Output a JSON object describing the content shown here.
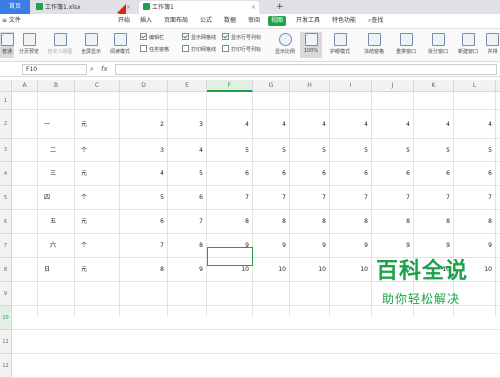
{
  "tabs": {
    "home": "首页",
    "doc1": "工作簿1.xlsx",
    "doc2": "工作簿1",
    "add": "+",
    "close": "×"
  },
  "menu": {
    "file": "≡ 文件",
    "items": [
      "开始",
      "插入",
      "页面布局",
      "公式",
      "数据",
      "审阅",
      "视图",
      "开发工具",
      "特色功能"
    ],
    "search": "查找"
  },
  "ribbon": {
    "normal": "普通",
    "page_preview": "分页预览",
    "custom_view": "自定义视图",
    "fullscreen": "全屏显示",
    "reading": "阅读模式",
    "checks": {
      "edit_bar": "编辑栏",
      "task_pane": "任务窗格",
      "show_grid": "显示网格线",
      "print_grid": "打印网格线",
      "show_rowcol": "显示行号列标",
      "print_rowcol": "打印行号列标"
    },
    "zoom": "显示比例",
    "zoom_100": "100%",
    "eye_mode": "护眼模式",
    "freeze": "冻结窗格",
    "rearrange": "重排窗口",
    "split": "拆分窗口",
    "new_window": "新建窗口",
    "side_by_side": "并排"
  },
  "formula_bar": {
    "cell_ref": "F10",
    "fx": "fx"
  },
  "grid": {
    "columns": [
      "A",
      "B",
      "C",
      "D",
      "E",
      "F",
      "G",
      "H",
      "I",
      "J",
      "K",
      "L",
      "M"
    ],
    "rows": [
      "1",
      "2",
      "3",
      "4",
      "5",
      "6",
      "7",
      "8",
      "9",
      "10",
      "11",
      "12"
    ],
    "selected_cell": "F10",
    "data": [
      [
        "一",
        "元",
        "2",
        "3",
        "4",
        "4",
        "4",
        "4",
        "4",
        "4",
        "4"
      ],
      [
        "二",
        "个",
        "3",
        "4",
        "5",
        "5",
        "5",
        "5",
        "5",
        "5",
        "5"
      ],
      [
        "三",
        "元",
        "4",
        "5",
        "6",
        "6",
        "6",
        "6",
        "6",
        "6",
        "6"
      ],
      [
        "四",
        "个",
        "5",
        "6",
        "7",
        "7",
        "7",
        "7",
        "7",
        "7",
        "7"
      ],
      [
        "五",
        "元",
        "6",
        "7",
        "8",
        "8",
        "8",
        "8",
        "8",
        "8",
        "8"
      ],
      [
        "六",
        "个",
        "7",
        "8",
        "9",
        "9",
        "9",
        "9",
        "9",
        "9",
        "9"
      ],
      [
        "日",
        "元",
        "8",
        "9",
        "10",
        "10",
        "10",
        "10",
        "10",
        "10",
        "10"
      ]
    ]
  },
  "watermark": {
    "line1": "百科全说",
    "line2": "助你轻松解决"
  },
  "colors": {
    "accent": "#1fa34a",
    "tab_blue": "#3c7ce6",
    "arrow": "#e0201b"
  }
}
